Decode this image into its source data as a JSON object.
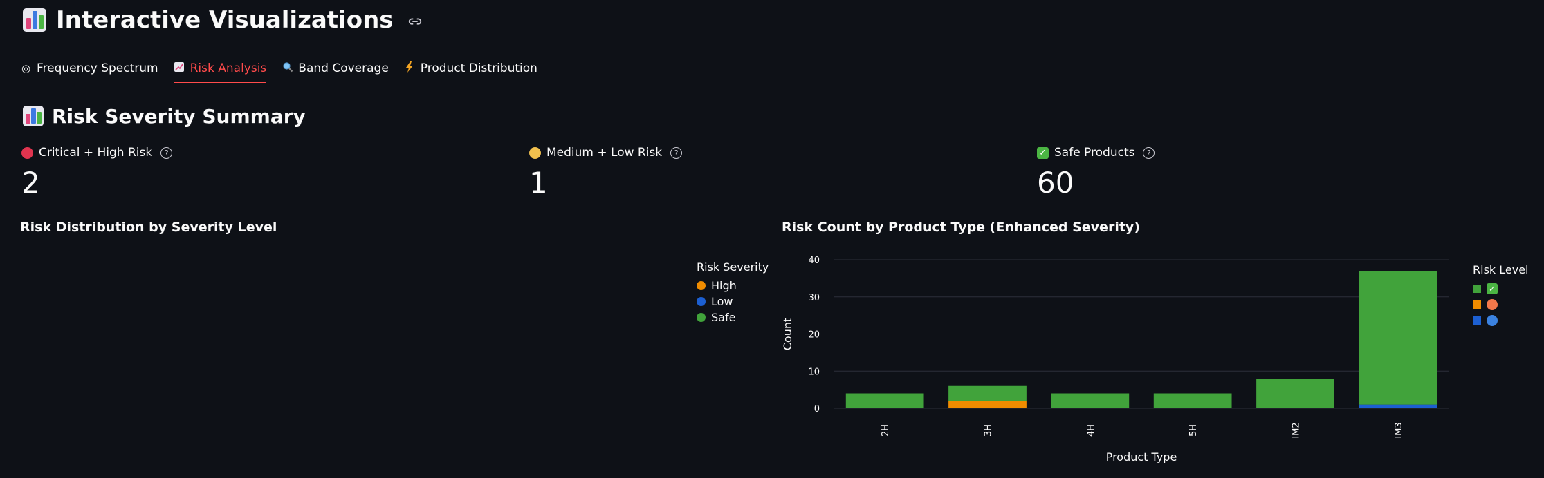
{
  "header": {
    "title": "Interactive Visualizations"
  },
  "tabs": [
    {
      "label": "Frequency Spectrum",
      "icon": "target-icon",
      "active": false
    },
    {
      "label": "Risk Analysis",
      "icon": "chart-increasing-icon",
      "active": true
    },
    {
      "label": "Band Coverage",
      "icon": "magnifier-icon",
      "active": false
    },
    {
      "label": "Product Distribution",
      "icon": "lightning-icon",
      "active": false
    }
  ],
  "section": {
    "title": "Risk Severity Summary"
  },
  "metrics": [
    {
      "label": "Critical + High Risk",
      "value": "2",
      "icon": "red-circle-icon"
    },
    {
      "label": "Medium + Low Risk",
      "value": "1",
      "icon": "yellow-circle-icon"
    },
    {
      "label": "Safe Products",
      "value": "60",
      "icon": "check-box-icon"
    }
  ],
  "pie_chart": {
    "title": "Risk Distribution by Severity Level",
    "legend_title": "Risk Severity",
    "legend": [
      {
        "label": "High",
        "color": "#f08c00"
      },
      {
        "label": "Low",
        "color": "#1c5fd1"
      },
      {
        "label": "Safe",
        "color": "#41a33b"
      }
    ]
  },
  "bar_chart": {
    "title": "Risk Count by Product Type (Enhanced Severity)",
    "legend_title": "Risk Level",
    "legend": [
      {
        "icon": "check-box-icon",
        "color": "#41a33b"
      },
      {
        "icon": "orange-circle-icon",
        "color": "#f08c00"
      },
      {
        "icon": "blue-circle-icon",
        "color": "#1c5fd1"
      }
    ]
  },
  "chart_data": {
    "type": "bar",
    "stacked": true,
    "title": "Risk Count by Product Type (Enhanced Severity)",
    "xlabel": "Product Type",
    "ylabel": "Count",
    "ylim": [
      0,
      40
    ],
    "yticks": [
      0,
      10,
      20,
      30,
      40
    ],
    "categories": [
      "2H",
      "3H",
      "4H",
      "5H",
      "IM2",
      "IM3"
    ],
    "series": [
      {
        "color": "#1c5fd1",
        "values": [
          0,
          0,
          0,
          0,
          0,
          1
        ]
      },
      {
        "color": "#f08c00",
        "values": [
          0,
          2,
          0,
          0,
          0,
          0
        ]
      },
      {
        "color": "#41a33b",
        "values": [
          4,
          4,
          4,
          4,
          8,
          36
        ]
      }
    ],
    "grid": true,
    "legend_position": "right"
  }
}
